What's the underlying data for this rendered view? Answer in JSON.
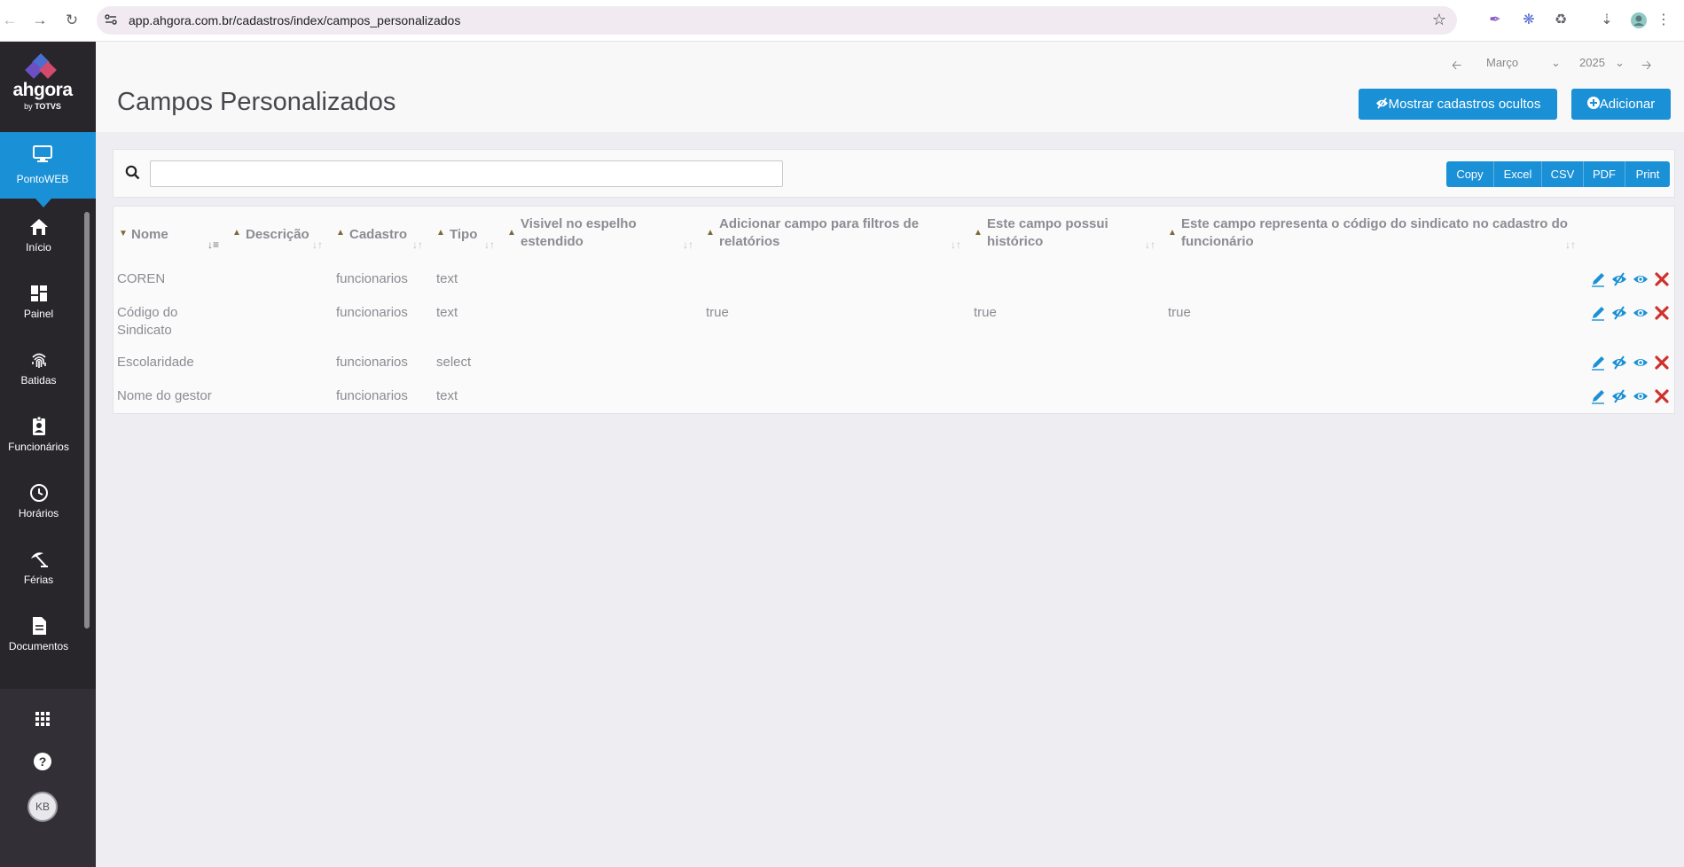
{
  "browser": {
    "url": "app.ahgora.com.br/cadastros/index/campos_personalizados"
  },
  "sidebar": {
    "logo_name": "ahgora",
    "logo_by": "by",
    "logo_brand": "TOTVS",
    "active_item": "PontoWEB",
    "items": [
      {
        "label": "Início",
        "icon": "home-icon"
      },
      {
        "label": "Painel",
        "icon": "dashboard-icon"
      },
      {
        "label": "Batidas",
        "icon": "fingerprint-icon"
      },
      {
        "label": "Funcionários",
        "icon": "badge-icon"
      },
      {
        "label": "Horários",
        "icon": "clock-icon"
      },
      {
        "label": "Férias",
        "icon": "beach-umbrella-icon"
      },
      {
        "label": "Documentos",
        "icon": "document-icon"
      }
    ],
    "avatar_initials": "KB"
  },
  "header": {
    "title": "Campos Personalizados",
    "month": "Março",
    "year": "2025",
    "show_hidden_button": "Mostrar cadastros ocultos",
    "add_button": "Adicionar"
  },
  "toolbar": {
    "search_placeholder": "",
    "export_buttons": [
      "Copy",
      "Excel",
      "CSV",
      "PDF",
      "Print"
    ]
  },
  "table": {
    "columns": [
      {
        "line1": "Nome",
        "line2": ""
      },
      {
        "line1": "Descrição",
        "line2": ""
      },
      {
        "line1": "Cadastro",
        "line2": ""
      },
      {
        "line1": "Tipo",
        "line2": ""
      },
      {
        "line1": "Visivel no espelho",
        "line2": "estendido"
      },
      {
        "line1": "Adicionar campo para filtros de",
        "line2": "relatórios"
      },
      {
        "line1": "Este campo possui",
        "line2": "histórico"
      },
      {
        "line1": "Este campo representa o código do sindicato no cadastro do",
        "line2": "funcionário"
      }
    ],
    "rows": [
      {
        "nome_1": "COREN",
        "nome_2": "",
        "descricao": "",
        "cadastro": "funcionarios",
        "tipo": "text",
        "visivel": "",
        "filtros": "",
        "historico": "",
        "sindicato": ""
      },
      {
        "nome_1": "Código do",
        "nome_2": "Sindicato",
        "descricao": "",
        "cadastro": "funcionarios",
        "tipo": "text",
        "visivel": "",
        "filtros": "true",
        "historico": "true",
        "sindicato": "true"
      },
      {
        "nome_1": "Escolaridade",
        "nome_2": "",
        "descricao": "",
        "cadastro": "funcionarios",
        "tipo": "select",
        "visivel": "",
        "filtros": "",
        "historico": "",
        "sindicato": ""
      },
      {
        "nome_1": "Nome do gestor",
        "nome_2": "",
        "descricao": "",
        "cadastro": "funcionarios",
        "tipo": "text",
        "visivel": "",
        "filtros": "",
        "historico": "",
        "sindicato": ""
      }
    ]
  },
  "colors": {
    "accent": "#1a90d6",
    "sidebar": "#28262b",
    "danger": "#d0312d"
  }
}
